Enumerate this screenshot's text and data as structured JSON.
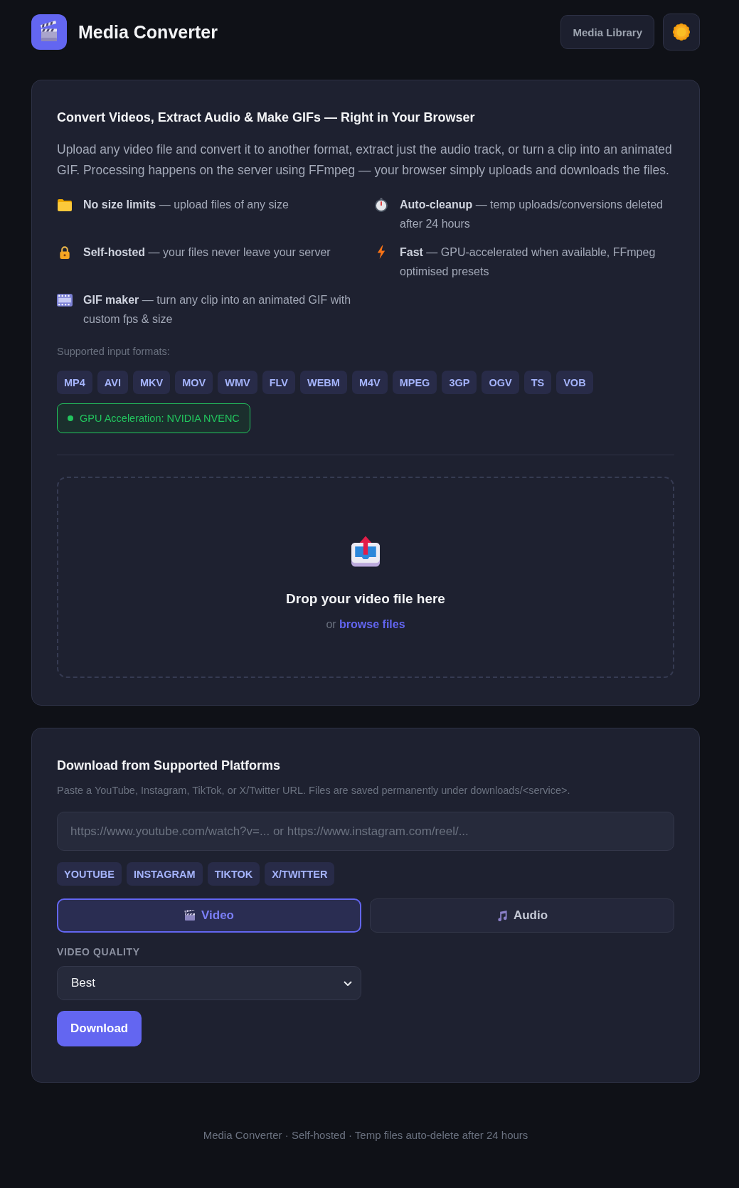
{
  "header": {
    "title": "Media Converter",
    "library_button": "Media Library"
  },
  "converter": {
    "title": "Convert Videos, Extract Audio & Make GIFs — Right in Your Browser",
    "description": "Upload any video file and convert it to another format, extract just the audio track, or turn a clip into an animated GIF. Processing happens on the server using FFmpeg — your browser simply uploads and downloads the files.",
    "features": [
      {
        "kind": "storage",
        "text": "**No size limits** — upload files of any size"
      },
      {
        "kind": "cleanup",
        "text": "**Auto-cleanup** — temp uploads/conversions deleted after 24 hours"
      },
      {
        "kind": "privacy",
        "text": "**Self-hosted** — your files never leave your server"
      },
      {
        "kind": "speed",
        "text": "**Fast** — GPU-accelerated when available, FFmpeg optimised presets"
      },
      {
        "kind": "gif",
        "text": "**GIF maker** — turn any clip into an animated GIF with custom fps & size"
      }
    ],
    "formats_label": "Supported input formats:",
    "formats": [
      "MP4",
      "AVI",
      "MKV",
      "MOV",
      "WMV",
      "FLV",
      "WEBM",
      "M4V",
      "MPEG",
      "3GP",
      "OGV",
      "TS",
      "VOB"
    ],
    "gpu": {
      "text": "GPU Acceleration: NVIDIA NVENC",
      "active": true
    },
    "dropzone": {
      "title": "Drop your video file here",
      "prompt": "or",
      "link": "browse files"
    }
  },
  "downloader": {
    "title": "Download from Supported Platforms",
    "hint": "Paste a YouTube, Instagram, TikTok, or X/Twitter URL. Files are saved permanently under downloads/<service>.",
    "url_field": {
      "placeholder": "https://www.youtube.com/watch?v=... or https://www.instagram.com/reel/..."
    },
    "platforms": [
      "YOUTUBE",
      "INSTAGRAM",
      "TIKTOK",
      "X/TWITTER"
    ],
    "modes": [
      {
        "kind": "video",
        "label": "Video",
        "selected": true
      },
      {
        "kind": "audio",
        "label": "Audio",
        "selected": false
      }
    ],
    "quality": {
      "label": "VIDEO QUALITY",
      "value": "Best"
    },
    "download_button": "Download"
  },
  "footer": "Media Converter · Self-hosted · Temp files auto-delete after 24 hours"
}
